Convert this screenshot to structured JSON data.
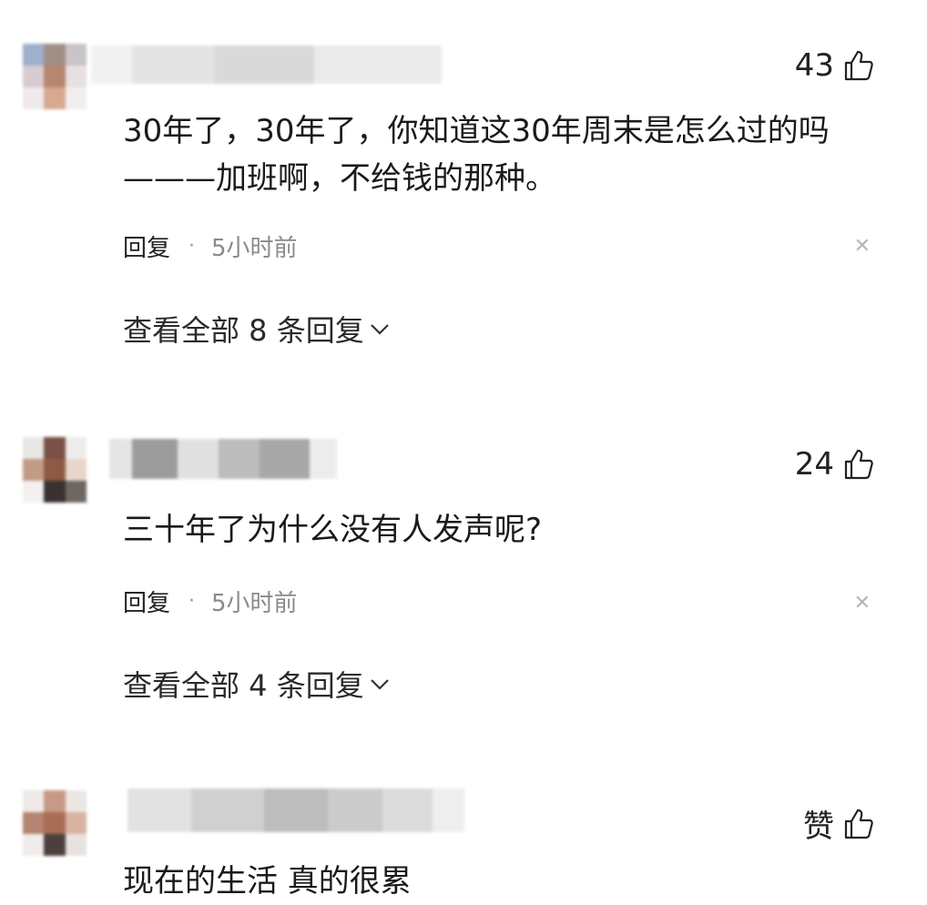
{
  "comments": [
    {
      "likes": "43",
      "text": "30年了，30年了，你知道这30年周末是怎么过的吗\n———加班啊，不给钱的那种。",
      "reply_label": "回复",
      "separator": "·",
      "time": "5小时前",
      "view_replies": "查看全部 8 条回复"
    },
    {
      "likes": "24",
      "text": "三十年了为什么没有人发声呢?",
      "reply_label": "回复",
      "separator": "·",
      "time": "5小时前",
      "view_replies": "查看全部 4 条回复"
    },
    {
      "likes": "赞",
      "text": "现在的生活 真的很累"
    }
  ],
  "icons": {
    "like": "thumbs-up-icon",
    "close": "close-icon",
    "expand": "chevron-down-icon"
  },
  "colors": {
    "text": "#1a1a1a",
    "meta": "#8a8a8a",
    "close": "#b5b5b5"
  }
}
